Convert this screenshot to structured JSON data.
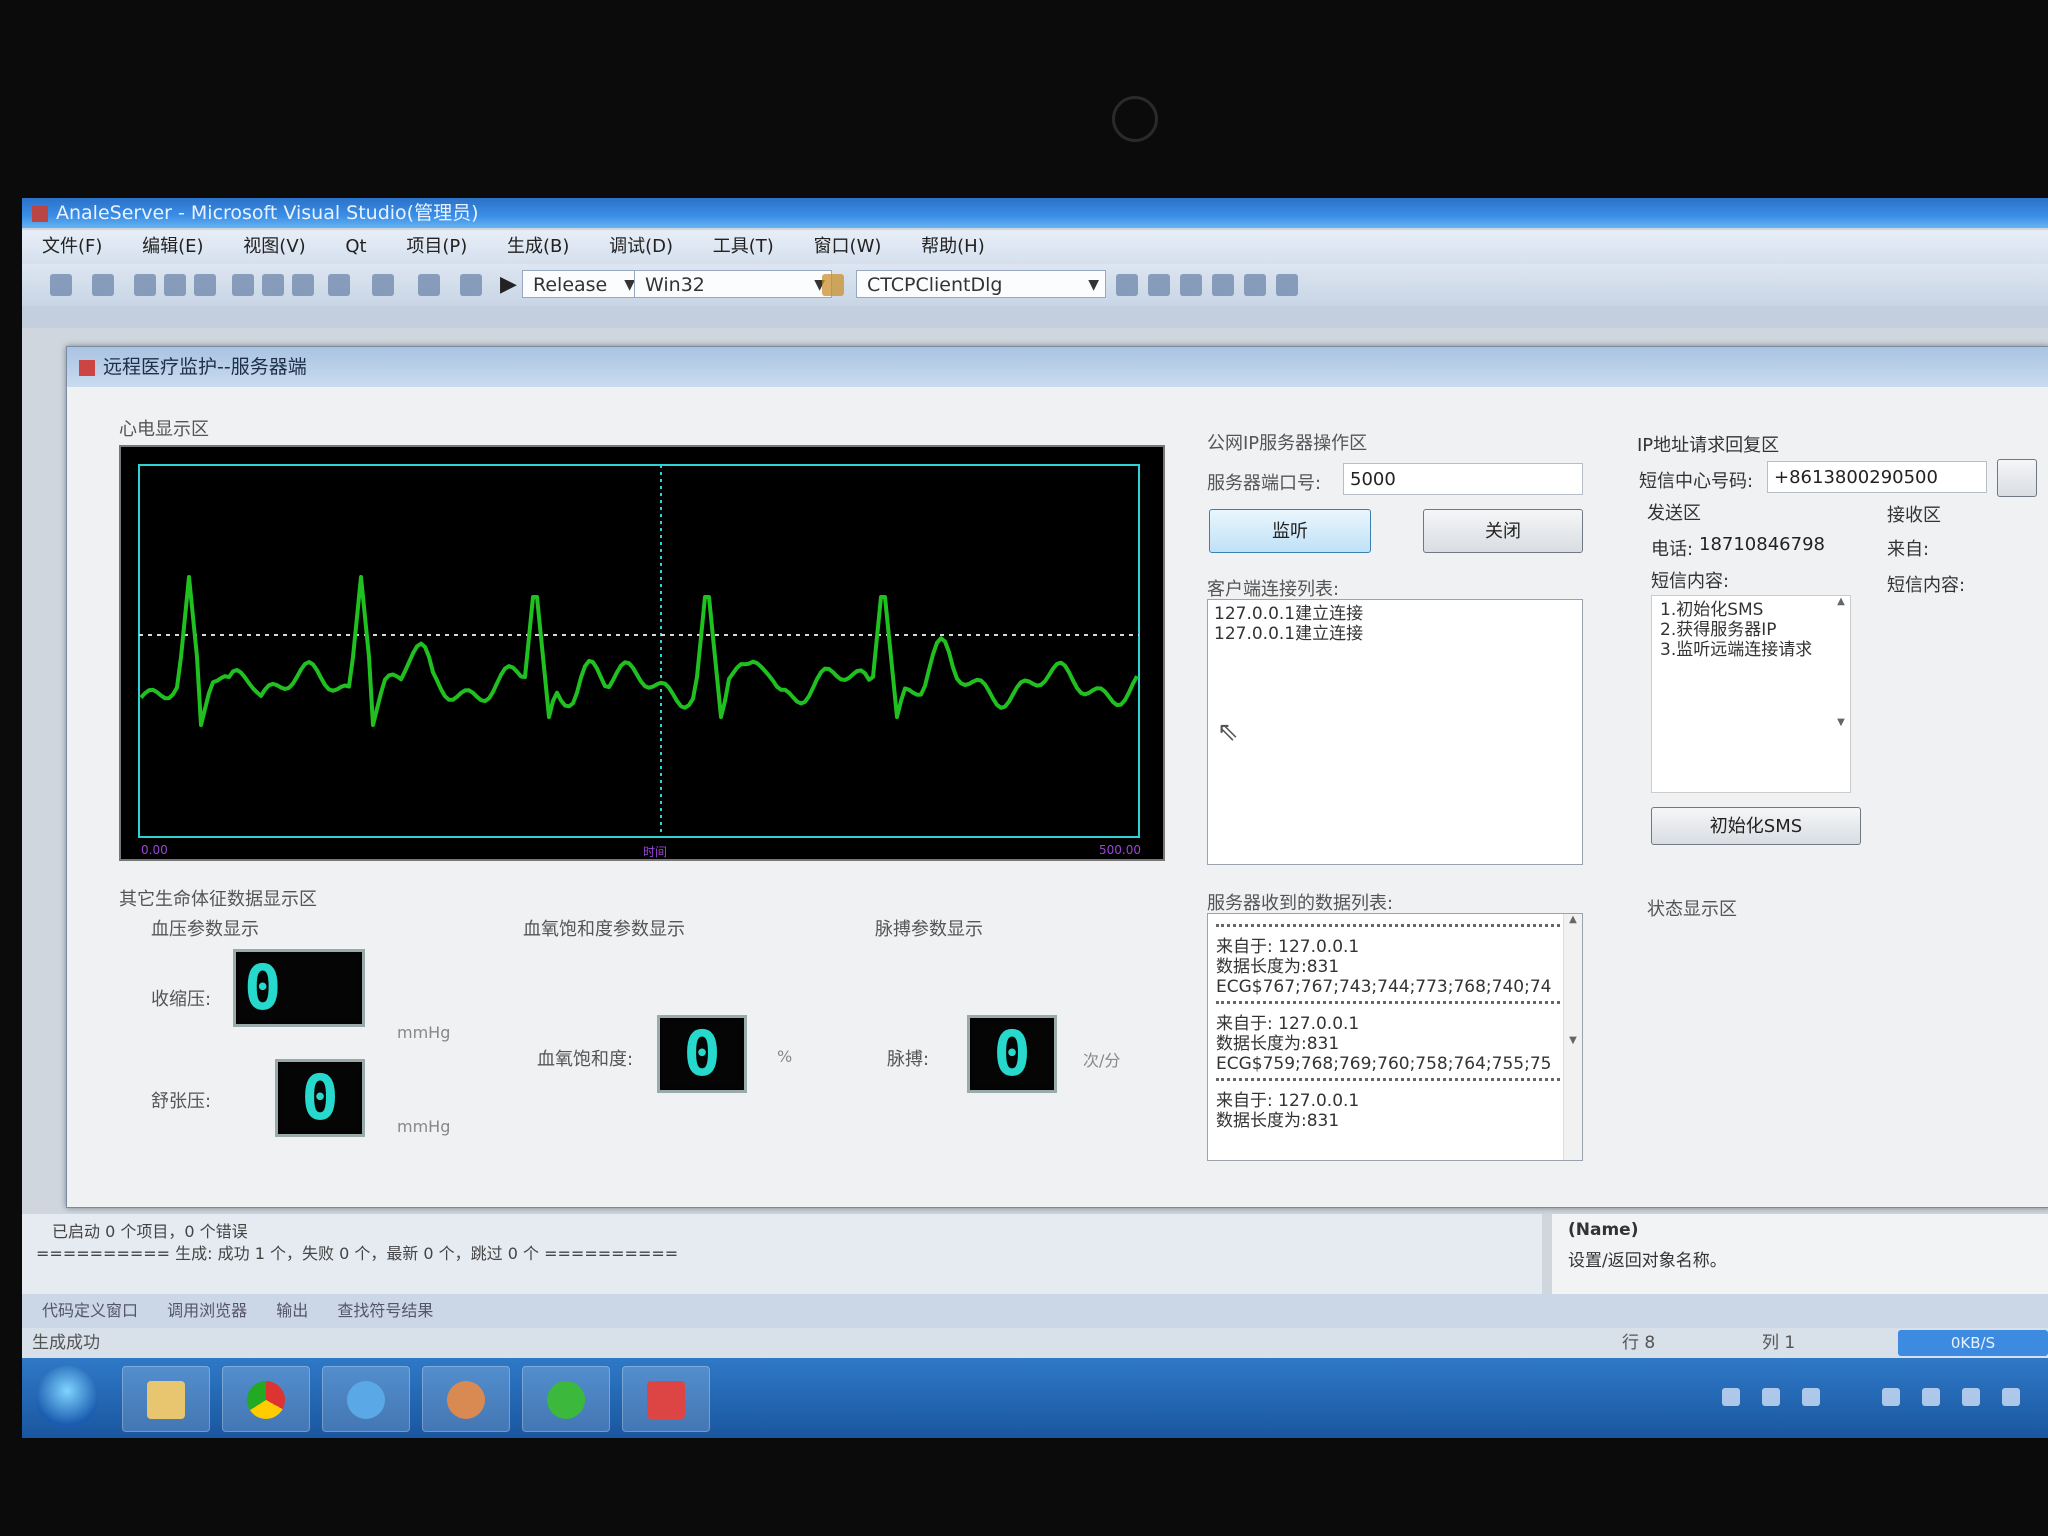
{
  "vs": {
    "title": "AnaleServer - Microsoft Visual Studio(管理员)",
    "menu": [
      "文件(F)",
      "编辑(E)",
      "视图(V)",
      "Qt",
      "项目(P)",
      "生成(B)",
      "调试(D)",
      "工具(T)",
      "窗口(W)",
      "帮助(H)"
    ],
    "config": "Release",
    "platform": "Win32",
    "class_combo": "CTCPClientDlg"
  },
  "dialog": {
    "title": "远程医疗监护--服务器端",
    "ecg_section": "心电显示区",
    "ecg_axis": {
      "left": "0.00",
      "mid": "时间",
      "right": "500.00"
    },
    "vitals_section": "其它生命体征数据显示区",
    "bp": {
      "title": "血压参数显示",
      "systolic_label": "收缩压:",
      "systolic_value": "0",
      "diastolic_label": "舒张压:",
      "diastolic_value": "0",
      "unit": "mmHg"
    },
    "spo2": {
      "title": "血氧饱和度参数显示",
      "label": "血氧饱和度:",
      "value": "0",
      "unit": "%"
    },
    "pulse": {
      "title": "脉搏参数显示",
      "label": "脉搏:",
      "value": "0",
      "unit": "次/分"
    },
    "server": {
      "section": "公网IP服务器操作区",
      "port_label": "服务器端口号:",
      "port_value": "5000",
      "listen_btn": "监听",
      "close_btn": "关闭",
      "clients_label": "客户端连接列表:",
      "clients": [
        "127.0.0.1建立连接",
        "127.0.0.1建立连接"
      ],
      "received_label": "服务器收到的数据列表:",
      "received": [
        {
          "from": "来自于: 127.0.0.1",
          "len": "数据长度为:831",
          "data": "ECG$767;767;743;744;773;768;740;74"
        },
        {
          "from": "来自于: 127.0.0.1",
          "len": "数据长度为:831",
          "data": "ECG$759;768;769;760;758;764;755;75"
        },
        {
          "from": "来自于: 127.0.0.1",
          "len": "数据长度为:831",
          "data": ""
        }
      ]
    },
    "sms": {
      "section": "IP地址请求回复区",
      "center_label": "短信中心号码:",
      "center_value": "+8613800290500",
      "send_section": "发送区",
      "phone_label": "电话:",
      "phone_value": "18710846798",
      "content_label": "短信内容:",
      "steps": [
        "1.初始化SMS",
        "2.获得服务器IP",
        "3.监听远端连接请求"
      ],
      "init_btn": "初始化SMS",
      "recv_section": "接收区",
      "from_label": "来自:",
      "recv_content_label": "短信内容:",
      "status_section": "状态显示区"
    }
  },
  "output": {
    "line1": "已启动 0 个项目，0 个错误",
    "line2": "========== 生成: 成功 1 个，失败 0 个，最新 0 个，跳过 0 个 =========="
  },
  "properties": {
    "name": "(Name)",
    "desc": "设置/返回对象名称。"
  },
  "tabs": [
    "代码定义窗口",
    "调用浏览器",
    "输出",
    "查找符号结果"
  ],
  "status": {
    "left": "生成成功",
    "row": "行 8",
    "col": "列 1",
    "speed": "0KB/S"
  }
}
